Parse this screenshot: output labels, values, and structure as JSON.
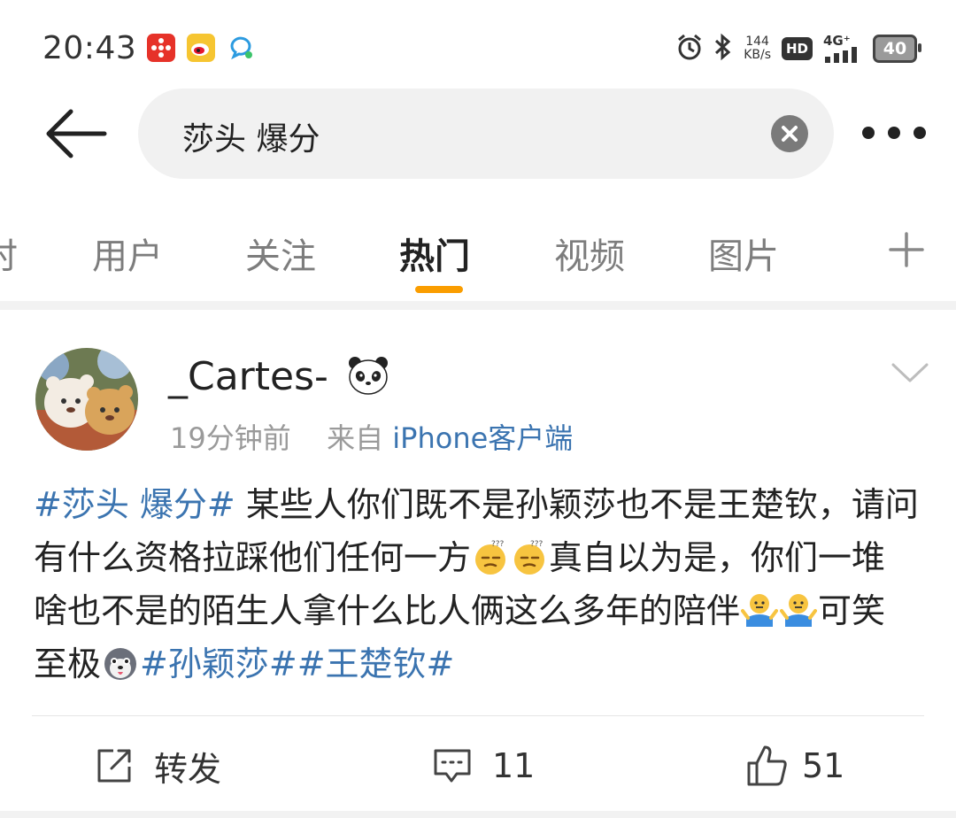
{
  "status_bar": {
    "time": "20:43",
    "net_speed_value": "144",
    "net_speed_unit": "KB/s",
    "hd_label": "HD",
    "network_type": "4G⁺",
    "battery_level": "40"
  },
  "header": {
    "search_query": "莎头 爆分"
  },
  "tabs": [
    {
      "label": "时"
    },
    {
      "label": "用户"
    },
    {
      "label": "关注"
    },
    {
      "label": "热门"
    },
    {
      "label": "视频"
    },
    {
      "label": "图片"
    }
  ],
  "active_tab": "热门",
  "post": {
    "username": "_Cartes-",
    "time_ago": "19分钟前",
    "source_prefix": "来自",
    "source_app": "iPhone客户端",
    "text_topic_1": "#莎头 爆分#",
    "text_1": " 某些人你们既不是孙颖莎也不是王楚钦，请问有什么资格拉踩他们任何一方",
    "text_2": "真自以为是，你们一堆啥也不是的陌生人拿什么比人俩这么多年的陪伴",
    "text_3": "可笑至极",
    "text_topic_2": "#孙颖莎#",
    "text_topic_3": "#王楚钦#",
    "repost_label": "转发",
    "comment_count": "11",
    "like_count": "51"
  },
  "colors": {
    "accent": "#fa9d00",
    "link": "#3b74b0",
    "muted_text": "#9a9a9a"
  },
  "icons": [
    "back-arrow-icon",
    "clear-icon",
    "more-icon",
    "plus-icon",
    "chevron-down-icon",
    "repost-icon",
    "comment-icon",
    "like-icon",
    "panda-emoji-icon"
  ]
}
